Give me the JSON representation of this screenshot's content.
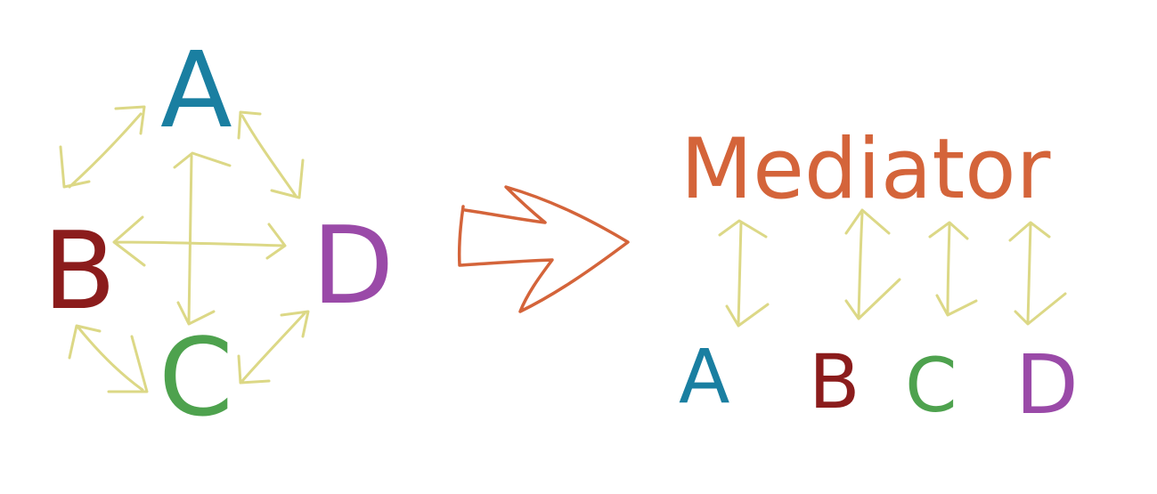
{
  "colors": {
    "a": "#1a7fa1",
    "b": "#8b1c1c",
    "c": "#4ea24e",
    "d": "#9a4aa8",
    "arrow": "#dcd886",
    "mediator": "#d4643a",
    "big_arrow": "#d4643a",
    "background": "#ffffff"
  },
  "left_diagram": {
    "node_a": "A",
    "node_b": "B",
    "node_c": "C",
    "node_d": "D"
  },
  "right_diagram": {
    "mediator_label": "Mediator",
    "node_a": "A",
    "node_b": "B",
    "node_c": "C",
    "node_d": "D"
  }
}
